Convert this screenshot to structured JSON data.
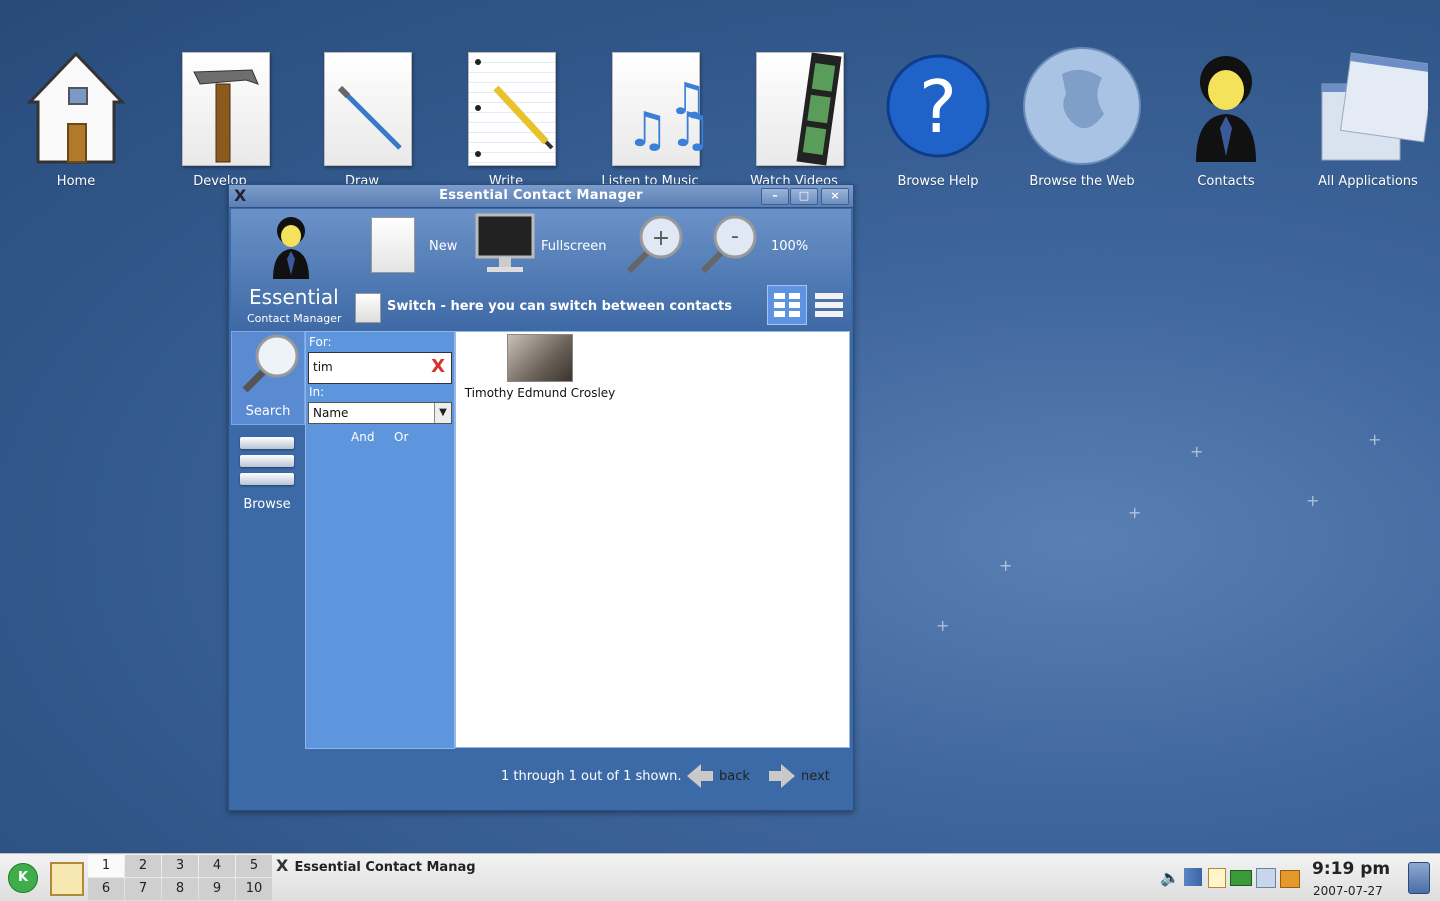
{
  "desktop": {
    "icons": [
      {
        "label": "Home"
      },
      {
        "label": "Develop"
      },
      {
        "label": "Draw"
      },
      {
        "label": "Write"
      },
      {
        "label": "Listen to Music"
      },
      {
        "label": "Watch Videos"
      },
      {
        "label": "Browse Help"
      },
      {
        "label": "Browse the Web"
      },
      {
        "label": "Contacts"
      },
      {
        "label": "All Applications"
      }
    ]
  },
  "window": {
    "title": "Essential Contact Manager",
    "toolbar": {
      "app_name": "Essential",
      "app_subtitle": "Contact Manager",
      "new_label": "New",
      "fullscreen_label": "Fullscreen",
      "zoom_level": "100%",
      "switch_text": "Switch - here you can switch between contacts"
    },
    "nav": {
      "search_label": "Search",
      "browse_label": "Browse"
    },
    "filter": {
      "for_label": "For:",
      "for_value": "tim",
      "in_label": "In:",
      "in_selected": "Name",
      "and_label": "And",
      "or_label": "Or"
    },
    "results": [
      {
        "name": "Timothy Edmund Crosley"
      }
    ],
    "footer": {
      "status": "1 through 1 out of 1 shown.",
      "back_label": "back",
      "next_label": "next"
    }
  },
  "taskbar": {
    "workspaces": [
      "1",
      "2",
      "3",
      "4",
      "5",
      "6",
      "7",
      "8",
      "9",
      "10"
    ],
    "active_workspace": "1",
    "task_label": "Essential Contact Manag",
    "clock_time": "9:19 pm",
    "clock_date": "2007-07-27"
  }
}
